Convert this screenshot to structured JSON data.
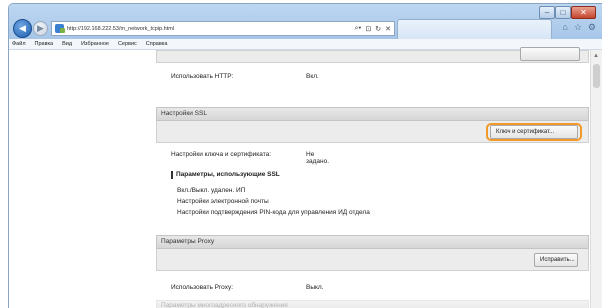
{
  "browser": {
    "url": "http://192.168.222.53/m_network_tcpip.html",
    "window_controls": {
      "minimize": "–",
      "maximize": "□",
      "close": "✕"
    },
    "address_tools": [
      "search-icon",
      "lock-icon",
      "refresh-icon",
      "close-icon"
    ],
    "toolbar_icons": [
      "home-icon",
      "star-icon",
      "gear-icon"
    ]
  },
  "menubar": {
    "items": [
      "Файл",
      "Правка",
      "Вид",
      "Избранное",
      "Сервис",
      "Справка"
    ]
  },
  "page": {
    "http_row": {
      "label": "Использовать HTTP:",
      "value": "Вкл."
    },
    "ssl_section": {
      "title": "Настройки SSL",
      "key_button": "Ключ и сертификат...",
      "key_row": {
        "label": "Настройки ключа и сертификата:",
        "value": "Не задано."
      },
      "params_title": "Параметры, использующие SSL",
      "params": [
        "Вкл./Выкл. удален. ИП",
        "Настройки электронной почты",
        "Настройки подтверждения PIN-кода для управления ИД отдела"
      ]
    },
    "proxy_section": {
      "title": "Параметры Proxy",
      "edit_button": "Исправить...",
      "proxy_row": {
        "label": "Использовать Proxy:",
        "value": "Выкл."
      }
    },
    "next_section_title": "Параметры многоадресного обнаружения"
  }
}
